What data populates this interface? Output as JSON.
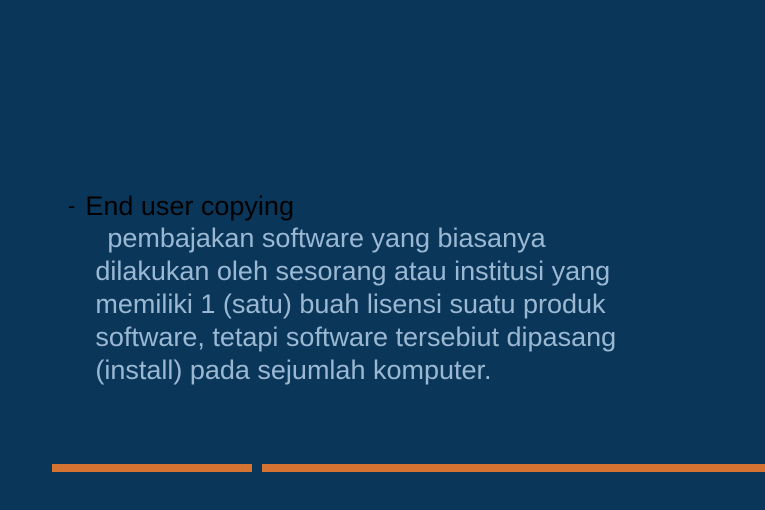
{
  "slide": {
    "bullet_dash": "-",
    "heading": "End user copying",
    "body_line1": " pembajakan software yang biasanya",
    "body_rest": "dilakukan oleh sesorang atau institusi yang memiliki 1 (satu)  buah lisensi suatu produk software, tetapi  software tersebiut dipasang (install) pada sejumlah komputer."
  },
  "colors": {
    "background": "#0a3659",
    "accent_bar": "#d57333",
    "body_text": "#9bb8d3",
    "heading_text": "#000000"
  }
}
